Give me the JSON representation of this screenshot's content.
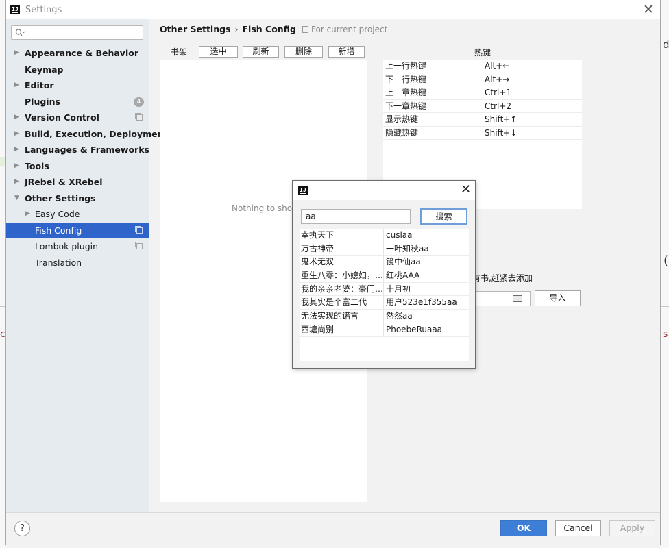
{
  "background": {
    "left_fragment": "co",
    "right_fragment_top": "d",
    "right_fragment_mid": "(",
    "right_fragment_bottom": "s"
  },
  "window": {
    "title": "Settings"
  },
  "sidebar": {
    "search_placeholder": "",
    "items": [
      {
        "label": "Appearance & Behavior"
      },
      {
        "label": "Keymap"
      },
      {
        "label": "Editor"
      },
      {
        "label": "Plugins",
        "badge": "4"
      },
      {
        "label": "Version Control"
      },
      {
        "label": "Build, Execution, Deployment"
      },
      {
        "label": "Languages & Frameworks"
      },
      {
        "label": "Tools"
      },
      {
        "label": "JRebel & XRebel"
      },
      {
        "label": "Other Settings"
      },
      {
        "label": "Easy Code"
      },
      {
        "label": "Fish Config"
      },
      {
        "label": "Lombok plugin"
      },
      {
        "label": "Translation"
      }
    ]
  },
  "breadcrumb": {
    "parent": "Other Settings",
    "current": "Fish Config",
    "scope": "For current project"
  },
  "bookshelf": {
    "label": "书架",
    "buttons": [
      "选中",
      "刷新",
      "删除",
      "新增"
    ],
    "empty_text": "Nothing to show"
  },
  "hotkeys": {
    "header": "热键",
    "rows": [
      {
        "action": "上一行热键",
        "key": "Alt+←"
      },
      {
        "action": "下一行热键",
        "key": "Alt+→"
      },
      {
        "action": "上一章热键",
        "key": "Ctrl+1"
      },
      {
        "action": "下一章热键",
        "key": "Ctrl+2"
      },
      {
        "action": "显示热键",
        "key": "Shift+↑"
      },
      {
        "action": "隐藏热键",
        "key": "Shift+↓"
      }
    ]
  },
  "import_area": {
    "hint_visible": "有书,赶紧去添加",
    "import_button": "导入"
  },
  "footer": {
    "help": "?",
    "ok": "OK",
    "cancel": "Cancel",
    "apply": "Apply"
  },
  "search_popup": {
    "query": "aa",
    "search_button": "搜索",
    "results": [
      {
        "title": "幸执天下",
        "author": "cuslaa"
      },
      {
        "title": "万古神帝",
        "author": "一叶知秋aa"
      },
      {
        "title": "鬼术无双",
        "author": "镜中仙aa"
      },
      {
        "title": "重生八零：小媳妇，…",
        "author": "红桃AAA"
      },
      {
        "title": "我的亲亲老婆：豪门…",
        "author": "十月初"
      },
      {
        "title": "我其实是个富二代",
        "author": "用户523e1f355aa"
      },
      {
        "title": "无法实现的诺言",
        "author": "然然aa"
      },
      {
        "title": "西塘尚别",
        "author": "PhoebeRuaaa"
      }
    ]
  }
}
